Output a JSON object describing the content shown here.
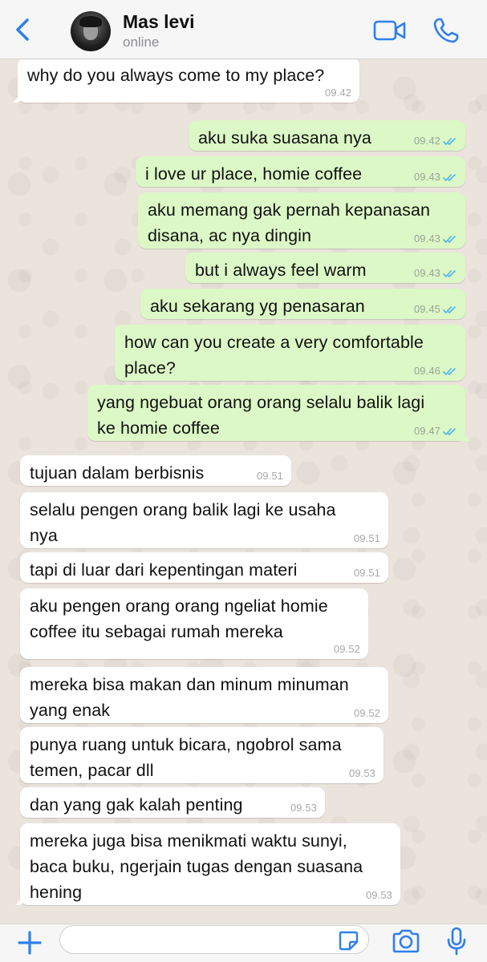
{
  "header": {
    "back_icon": "chevron-left-icon",
    "contact_name": "Mas levi",
    "status": "online",
    "video_icon": "video-camera-icon",
    "phone_icon": "phone-icon",
    "accent_color": "#2f80ed"
  },
  "messages": [
    {
      "dir": "in",
      "text": "why do you always come to my place?",
      "time": "09.42"
    },
    {
      "dir": "out",
      "text": "aku suka suasana nya",
      "time": "09.42",
      "read": true
    },
    {
      "dir": "out",
      "text": "i love ur place, homie coffee",
      "time": "09.43",
      "read": true
    },
    {
      "dir": "out",
      "text": "aku memang gak pernah kepanasan\ndisana, ac nya dingin",
      "time": "09.43",
      "read": true
    },
    {
      "dir": "out",
      "text": "but i always feel warm",
      "time": "09.43",
      "read": true
    },
    {
      "dir": "out",
      "text": "aku sekarang yg penasaran",
      "time": "09.45",
      "read": true
    },
    {
      "dir": "out",
      "text": "how can you create a very comfortable\nplace?",
      "time": "09.46",
      "read": true
    },
    {
      "dir": "out",
      "text": "yang ngebuat orang orang selalu balik lagi\nke homie coffee",
      "time": "09.47",
      "read": true
    },
    {
      "dir": "in",
      "text": "tujuan dalam berbisnis",
      "time": "09.51"
    },
    {
      "dir": "in",
      "text": "selalu pengen orang balik lagi ke usaha\nnya",
      "time": "09.51"
    },
    {
      "dir": "in",
      "text": "tapi di luar dari kepentingan materi",
      "time": "09.51"
    },
    {
      "dir": "in",
      "text": "aku pengen orang orang ngeliat homie\ncoffee itu sebagai rumah mereka",
      "time": "09.52"
    },
    {
      "dir": "in",
      "text": "mereka bisa makan dan minum minuman\nyang enak",
      "time": "09.52"
    },
    {
      "dir": "in",
      "text": "punya ruang untuk bicara, ngobrol sama\ntemen, pacar dll",
      "time": "09.53"
    },
    {
      "dir": "in",
      "text": "dan yang gak kalah penting",
      "time": "09.53"
    },
    {
      "dir": "in",
      "text": "mereka juga bisa menikmati waktu sunyi,\nbaca buku, ngerjain tugas dengan suasana\nhening",
      "time": "09.53"
    }
  ],
  "input_bar": {
    "plus_icon": "plus-icon",
    "input_value": "",
    "sticker_icon": "sticker-icon",
    "camera_icon": "camera-icon",
    "mic_icon": "microphone-icon"
  },
  "colors": {
    "incoming_bubble": "#ffffff",
    "outgoing_bubble": "#dcf8c6",
    "read_ticks": "#4fb6ec",
    "chat_background": "#ece5dd"
  }
}
